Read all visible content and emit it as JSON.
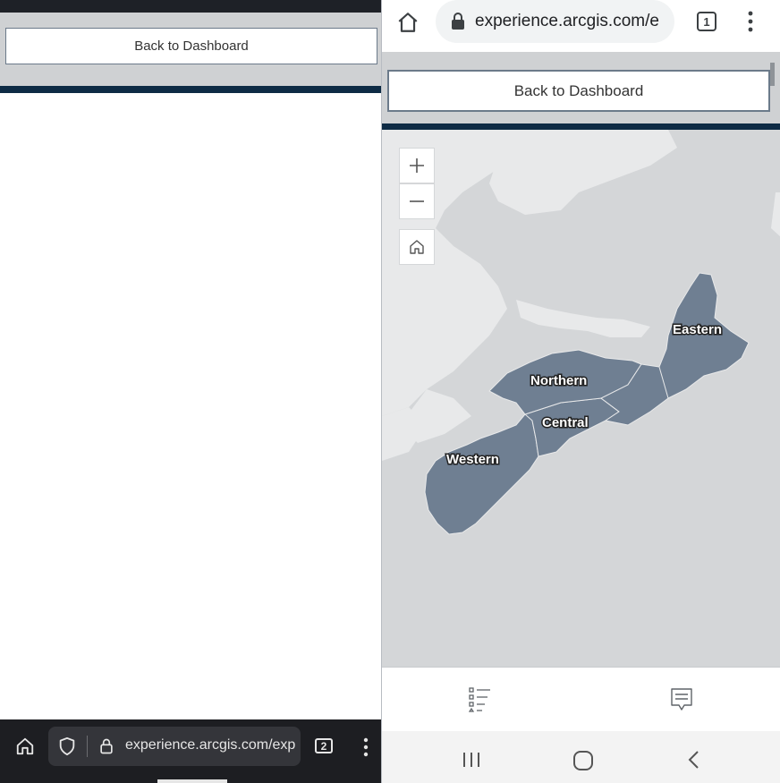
{
  "left_window": {
    "header_button_label": "Back to Dashboard",
    "url": "experience.arcgis.com/exp",
    "tab_count": "2",
    "icons": [
      "home-icon",
      "shield-icon",
      "lock-icon",
      "menu-dots-icon"
    ]
  },
  "right_window": {
    "url": "experience.arcgis.com/e",
    "tab_count": "1",
    "header_button_label": "Back to Dashboard",
    "map": {
      "regions": [
        {
          "name": "Eastern"
        },
        {
          "name": "Northern"
        },
        {
          "name": "Central"
        },
        {
          "name": "Western"
        }
      ],
      "controls": [
        "zoom-in",
        "zoom-out",
        "home"
      ]
    },
    "icons": [
      "home-icon",
      "lock-icon",
      "menu-dots-icon",
      "legend-list-icon",
      "info-comment-icon",
      "recents-icon",
      "home-nav-icon",
      "back-icon"
    ],
    "colors": {
      "region_fill": "#6f7f92",
      "land": "#e8e9ea",
      "water": "#d4d6d8",
      "stripe": "#0e2b45"
    }
  }
}
